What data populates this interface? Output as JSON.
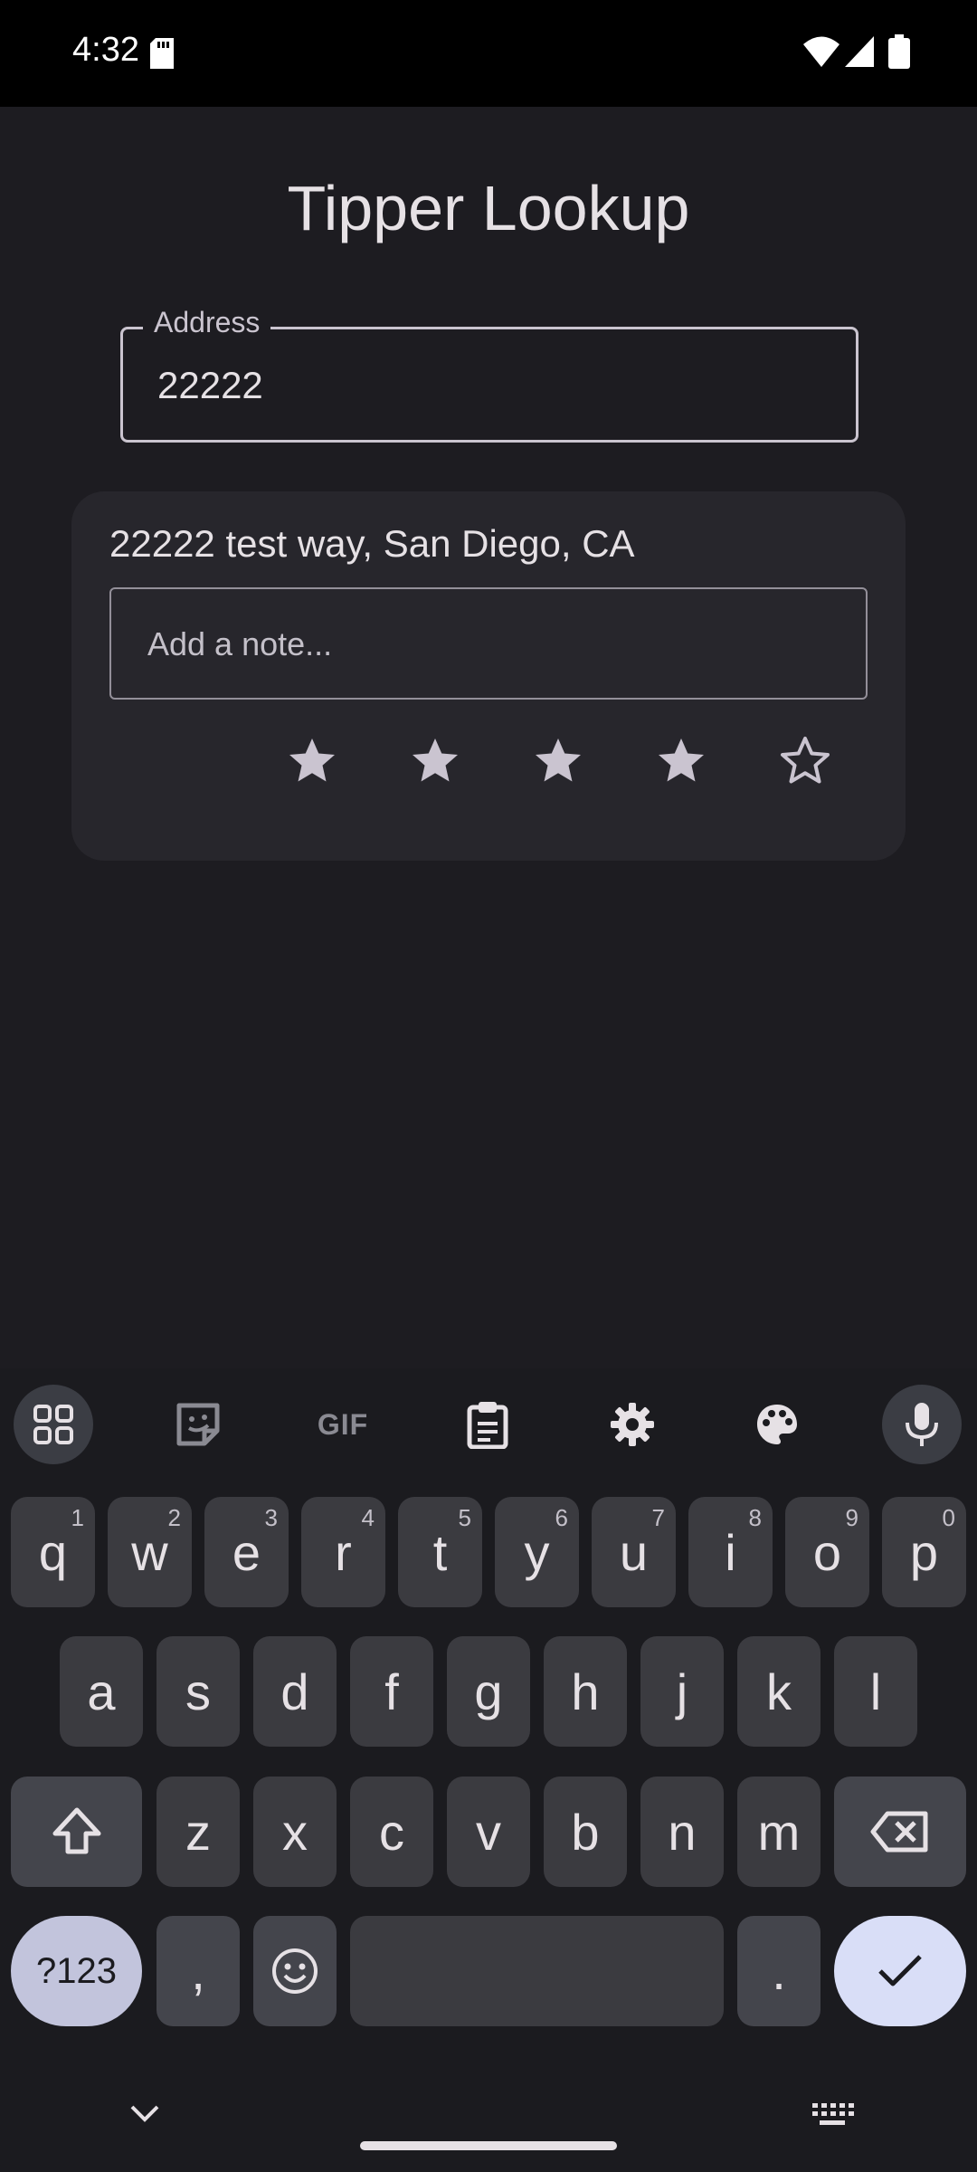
{
  "status_bar": {
    "time": "4:32"
  },
  "app": {
    "title": "Tipper Lookup"
  },
  "address_field": {
    "label": "Address",
    "value": "22222"
  },
  "result": {
    "address": "22222 test way, San Diego, CA",
    "note_placeholder": "Add a note...",
    "rating": 4,
    "max_rating": 5
  },
  "keyboard": {
    "toolbar": {
      "gif_label": "GIF"
    },
    "row1": [
      {
        "key": "q",
        "hint": "1"
      },
      {
        "key": "w",
        "hint": "2"
      },
      {
        "key": "e",
        "hint": "3"
      },
      {
        "key": "r",
        "hint": "4"
      },
      {
        "key": "t",
        "hint": "5"
      },
      {
        "key": "y",
        "hint": "6"
      },
      {
        "key": "u",
        "hint": "7"
      },
      {
        "key": "i",
        "hint": "8"
      },
      {
        "key": "o",
        "hint": "9"
      },
      {
        "key": "p",
        "hint": "0"
      }
    ],
    "row2": [
      "a",
      "s",
      "d",
      "f",
      "g",
      "h",
      "j",
      "k",
      "l"
    ],
    "row3": [
      "z",
      "x",
      "c",
      "v",
      "b",
      "n",
      "m"
    ],
    "symbols_label": "?123",
    "comma": ",",
    "period": "."
  },
  "colors": {
    "background": "#1d1c21",
    "card": "#27262c",
    "enter_key": "#d9def7",
    "symbols_key": "#c2c4dc"
  }
}
